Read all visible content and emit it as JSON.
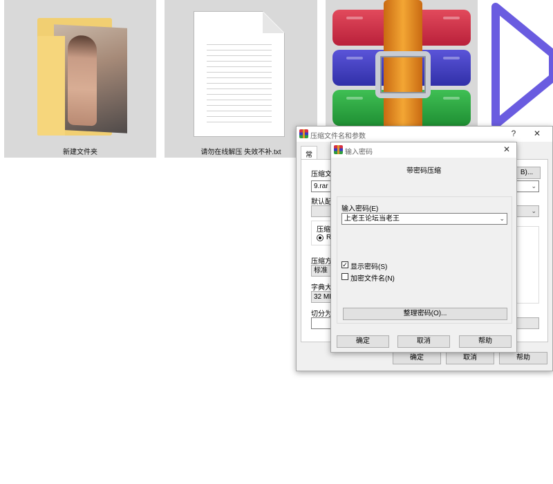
{
  "desktop": {
    "tiles": [
      {
        "label": "新建文件夹",
        "icon": "folder-icon"
      },
      {
        "label": "请勿在线解压 失效不补.txt",
        "icon": "text-file-icon"
      },
      {
        "label": "",
        "icon": "winrar-archive-icon"
      },
      {
        "label": "",
        "icon": "play-icon"
      }
    ]
  },
  "main_dialog": {
    "title": "压缩文件名和参数",
    "help_btn": "?",
    "close_btn": "✕",
    "tabs": [
      "常规"
    ],
    "archive_name_label": "压缩文",
    "browse_btn": "B)...",
    "archive_name_value": "9.rar",
    "default_profile_label": "默认配",
    "format_group_label": "压缩",
    "format_option": "RA",
    "method_label": "压缩方",
    "method_value": "标准",
    "dict_label": "字典大",
    "dict_value": "32 MB",
    "split_label": "切分为",
    "ok_btn": "确定",
    "cancel_btn": "取消",
    "help_button": "帮助"
  },
  "password_dialog": {
    "title": "输入密码",
    "close_btn": "✕",
    "heading": "带密码压缩",
    "enter_label": "输入密码(E)",
    "password_value": "上老王论坛当老王",
    "show_password_label": "显示密码(S)",
    "show_password_checked": true,
    "encrypt_names_label": "加密文件名(N)",
    "encrypt_names_checked": false,
    "organize_btn": "整理密码(O)...",
    "ok_btn": "确定",
    "cancel_btn": "取消",
    "help_btn": "帮助"
  },
  "colors": {
    "play_icon": "#6a5ce0",
    "dialog_bg": "#f0f0f0",
    "tile_bg": "#d9d9d9"
  }
}
